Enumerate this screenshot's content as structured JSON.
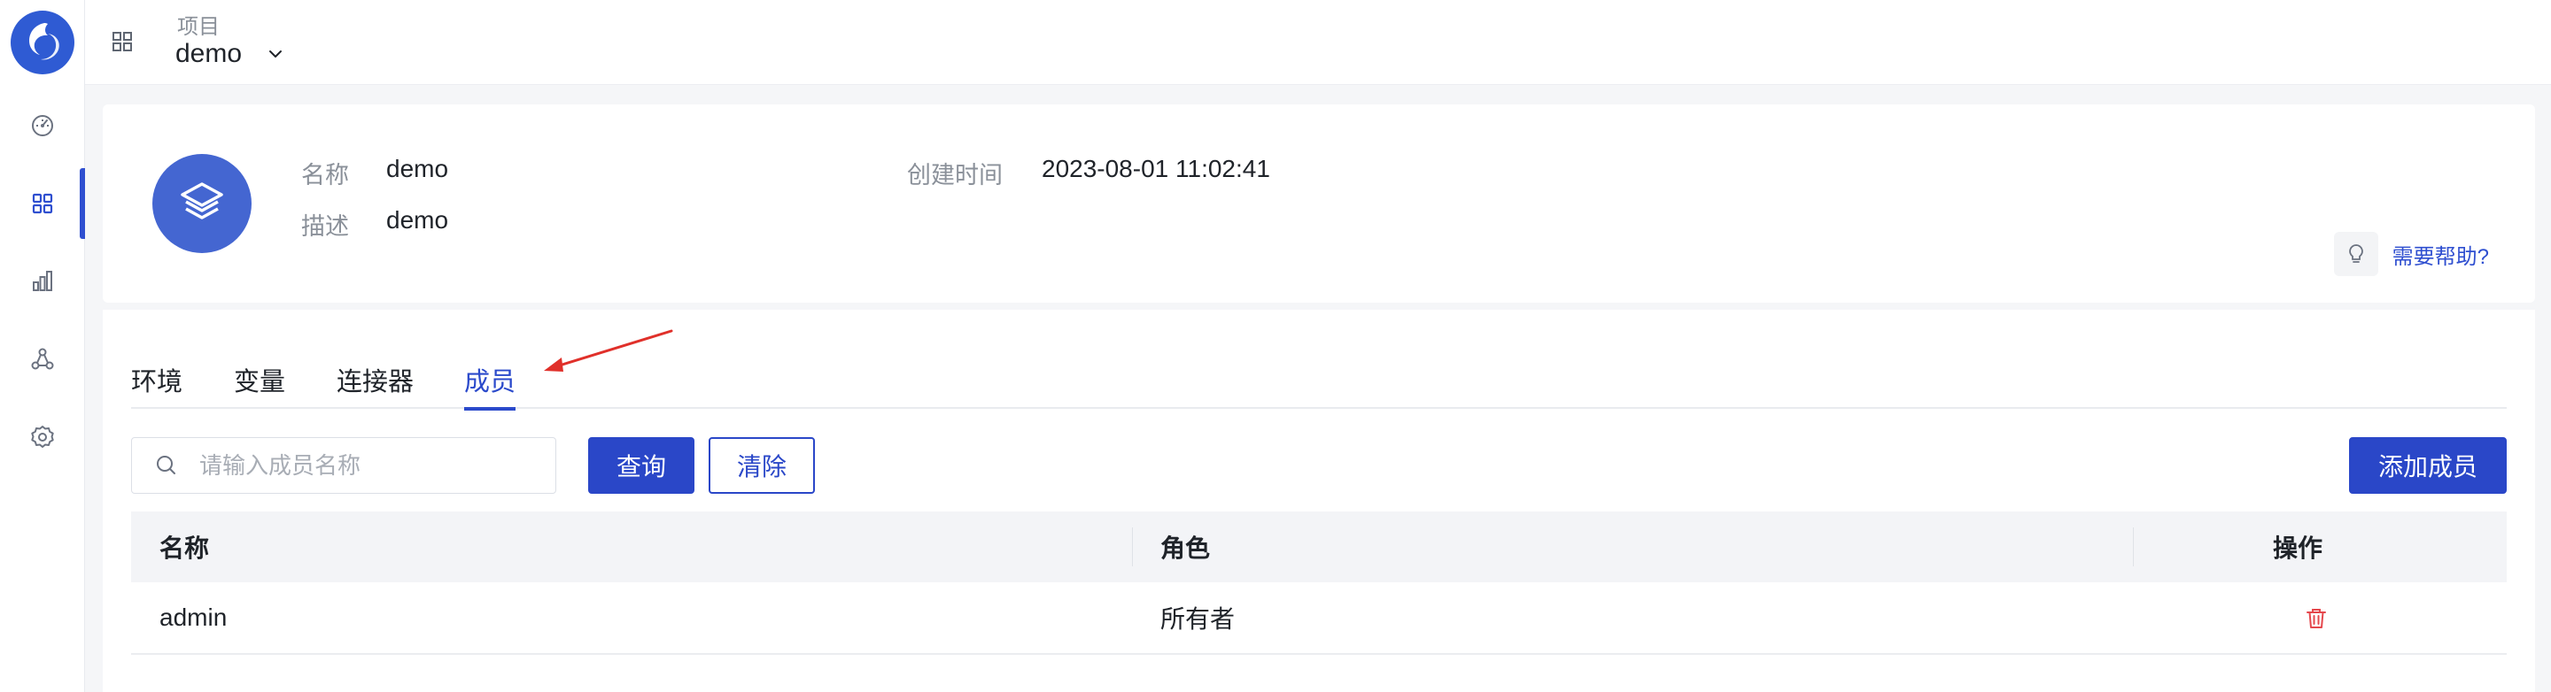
{
  "topbar": {
    "project_label": "项目",
    "project_value": "demo"
  },
  "sidebar": {
    "items": [
      {
        "icon": "dashboard-icon"
      },
      {
        "icon": "apps-grid-icon",
        "active": true
      },
      {
        "icon": "bar-chart-icon"
      },
      {
        "icon": "nodes-icon"
      },
      {
        "icon": "settings-icon"
      }
    ]
  },
  "project_info": {
    "name_label": "名称",
    "name_value": "demo",
    "desc_label": "描述",
    "desc_value": "demo",
    "created_label": "创建时间",
    "created_value": "2023-08-01 11:02:41",
    "help_text": "需要帮助?"
  },
  "tabs": [
    {
      "label": "环境"
    },
    {
      "label": "变量"
    },
    {
      "label": "连接器"
    },
    {
      "label": "成员",
      "active": true
    }
  ],
  "search": {
    "placeholder": "请输入成员名称",
    "query_button": "查询",
    "clear_button": "清除",
    "add_button": "添加成员"
  },
  "table": {
    "headers": {
      "name": "名称",
      "role": "角色",
      "actions": "操作"
    },
    "rows": [
      {
        "name": "admin",
        "role": "所有者"
      }
    ]
  },
  "colors": {
    "primary": "#2a47c8",
    "annotation_arrow": "#e0302a",
    "delete": "#e5484d"
  }
}
